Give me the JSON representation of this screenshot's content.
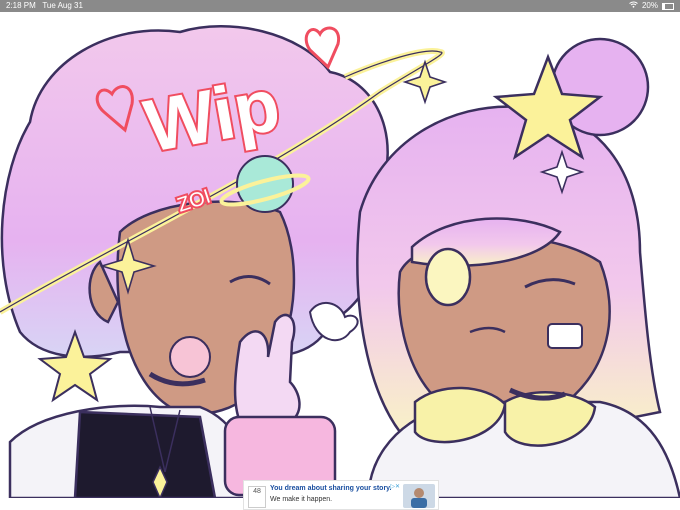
{
  "status_bar": {
    "time": "2:18 PM",
    "date": "Tue Aug 31",
    "battery": "20%",
    "battery_level": 0.2,
    "wifi_icon": "wifi-icon"
  },
  "artwork": {
    "wip_text": "Wip",
    "signature": "ZOI",
    "colors": {
      "hair_pink": "#f2c8ec",
      "hair_purple": "#e6b2f0",
      "hair_lavender": "#d8d4f5",
      "hair_blonde": "#f9f1c8",
      "skin": "#cf9a84",
      "outline": "#3b2f5e",
      "wip_red": "#f04d60",
      "star_yellow": "#fbf29a",
      "saturn_mint": "#a9e9d8",
      "sweater_yellow": "#f8f2a8",
      "sleeve_pink": "#f6b7df",
      "shirt_black": "#1e1a2e"
    }
  },
  "ad": {
    "headline": "You dream about sharing your story.",
    "subtext": "We make it happen.",
    "logo_text": "48",
    "choices_icon": "ad-choices-icon"
  }
}
